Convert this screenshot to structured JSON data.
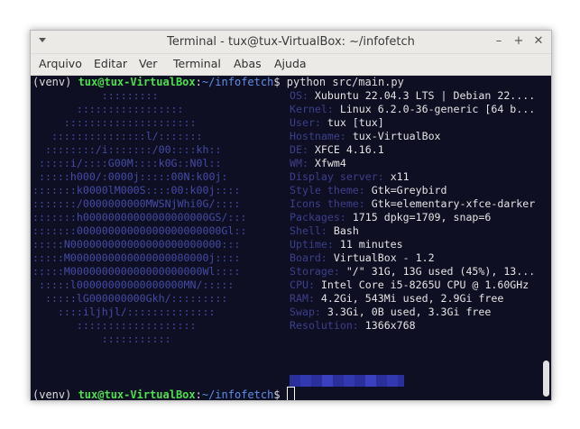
{
  "window": {
    "title": "Terminal - tux@tux-VirtualBox: ~/infofetch",
    "minimize": "–",
    "maximize": "+",
    "close": "✕"
  },
  "menu": [
    "Arquivo",
    "Editar",
    "Ver",
    "Terminal",
    "Abas",
    "Ajuda"
  ],
  "prompt1": {
    "venv": "(venv) ",
    "userhost": "tux@tux-VirtualBox",
    "colon": ":",
    "path": "~/infofetch",
    "dollar": "$ ",
    "command": "python src/main.py"
  },
  "logo": [
    "           :::::::::          ",
    "       :::::::::::::::::      ",
    "     :::::::::::::::::::::    ",
    "   :::::::::::::::l/:::::::   ",
    "  ::::::::/i:::::::/00::::kh:: ",
    " :::::i/::::G00M::::k0G::N0l::",
    " :::::h000/:0000j:::::00N:k00j:",
    ":::::::k0000lM000S::::00:k00j::::",
    ":::::::/0000000000MWSNjWhi0G/::::",
    ":::::::h00000000000000000000GS/:::",
    ":::::::00000000000000000000000Gl::",
    ":::::N000000000000000000000000:::",
    ":::::M0000000000000000000000j::::",
    ":::::M000000000000000000000Wl::::",
    " :::::l00000000000000000MN/::::: ",
    "  :::::lG000000000Gkh/:::::::::  ",
    "    ::::iljhjl/::::::::::::::    ",
    "       :::::::::::::::::::       ",
    "           :::::::::::           "
  ],
  "info": [
    {
      "key": "OS: ",
      "value": "Xubuntu 22.04.3 LTS | Debian 22...."
    },
    {
      "key": "Kernel: ",
      "value": "Linux 6.2.0-36-generic [64 b..."
    },
    {
      "key": "User: ",
      "value": "tux [tux]"
    },
    {
      "key": "Hostname: ",
      "value": "tux-VirtualBox"
    },
    {
      "key": "DE: ",
      "value": "XFCE 4.16.1"
    },
    {
      "key": "WM: ",
      "value": "Xfwm4"
    },
    {
      "key": "Display server: ",
      "value": "x11"
    },
    {
      "key": "Style theme: ",
      "value": "Gtk=Greybird"
    },
    {
      "key": "Icons theme: ",
      "value": "Gtk=elementary-xfce-darker"
    },
    {
      "key": "Packages: ",
      "value": "1715 dpkg=1709, snap=6"
    },
    {
      "key": "Shell: ",
      "value": "Bash"
    },
    {
      "key": "Uptime: ",
      "value": "11 minutes"
    },
    {
      "key": "Board: ",
      "value": "VirtualBox - 1.2"
    },
    {
      "key": "Storage: ",
      "value": "\"/\" 31G, 13G used (45%), 13..."
    },
    {
      "key": "CPU: ",
      "value": "Intel Core i5-8265U CPU @ 1.60GHz"
    },
    {
      "key": "RAM: ",
      "value": "4.2Gi, 543Mi used, 2.9Gi free"
    },
    {
      "key": "Swap: ",
      "value": "3.3Gi, 0B used, 3.3Gi free"
    },
    {
      "key": "Resolution: ",
      "value": "1366x768"
    }
  ],
  "palette_colors": [
    "#2a2f9c",
    "#3238b0",
    "#2a2f9c",
    "#3a40c0",
    "#2a2f9c",
    "#3238b0",
    "#2a2f9c",
    "#3a40c0",
    "#2a2f9c",
    "#3238b0"
  ],
  "prompt2": {
    "venv": "(venv) ",
    "userhost": "tux@tux-VirtualBox",
    "colon": ":",
    "path": "~/infofetch",
    "dollar": "$ "
  }
}
